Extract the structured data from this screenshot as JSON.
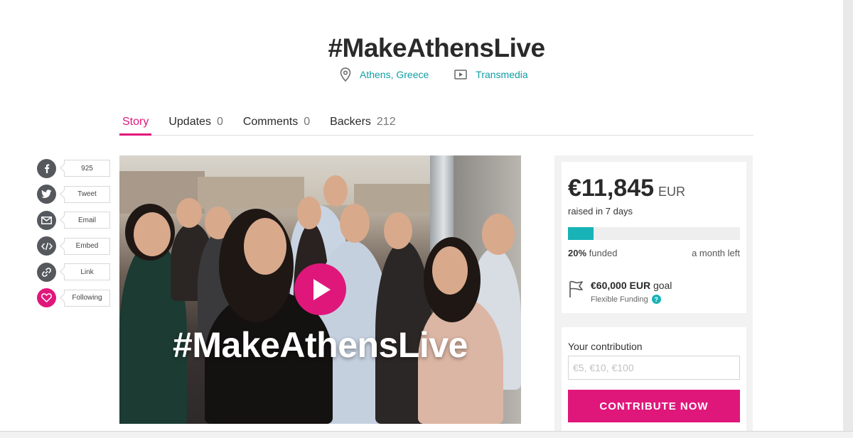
{
  "campaign": {
    "title": "#MakeAthensLive",
    "location": "Athens, Greece",
    "category": "Transmedia"
  },
  "tabs": [
    {
      "label": "Story",
      "count": "",
      "active": true
    },
    {
      "label": "Updates",
      "count": "0"
    },
    {
      "label": "Comments",
      "count": "0"
    },
    {
      "label": "Backers",
      "count": "212"
    }
  ],
  "share": [
    {
      "icon": "facebook-icon",
      "label": "925"
    },
    {
      "icon": "twitter-icon",
      "label": "Tweet"
    },
    {
      "icon": "email-icon",
      "label": "Email"
    },
    {
      "icon": "embed-icon",
      "label": "Embed"
    },
    {
      "icon": "link-icon",
      "label": "Link"
    },
    {
      "icon": "heart-icon",
      "label": "Following"
    }
  ],
  "video": {
    "overlay_title": "#MakeAthensLive",
    "play_icon": "play-icon"
  },
  "funding": {
    "amount": "€11,845",
    "currency": "EUR",
    "raised_text": "raised in 7 days",
    "progress_fraction": 0.15,
    "funded_percent": "20%",
    "funded_label": "funded",
    "time_left": "a month left",
    "goal_amount": "€60,000 EUR",
    "goal_label": "goal",
    "funding_type": "Flexible Funding"
  },
  "contribution": {
    "label": "Your contribution",
    "placeholder": "€5, €10, €100",
    "button_label": "CONTRIBUTE NOW"
  },
  "colors": {
    "accent": "#e0177b",
    "teal": "#17b3b6",
    "link": "#0f9ea5"
  }
}
